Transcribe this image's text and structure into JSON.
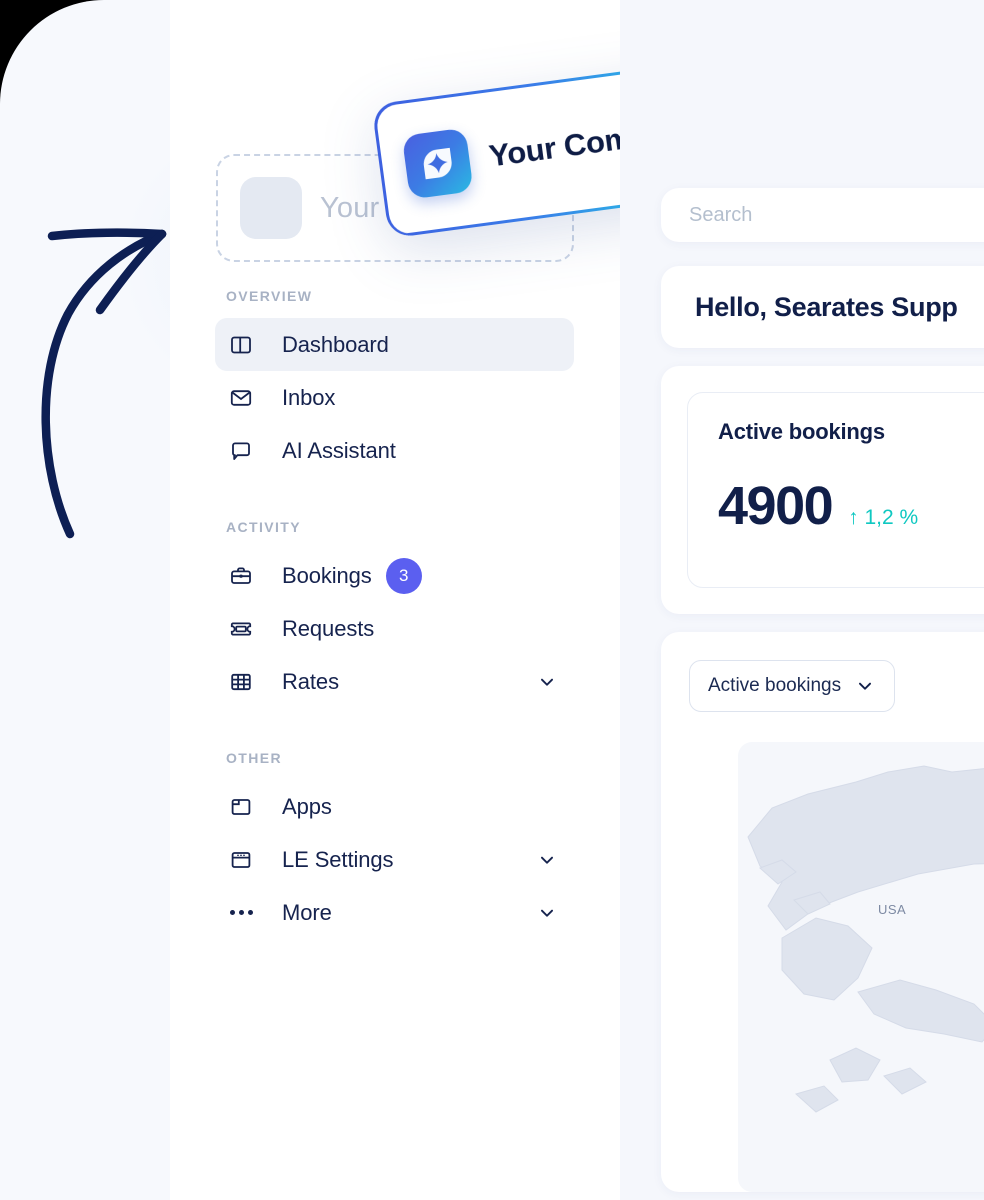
{
  "theme": {
    "page_bg": "#f7f9fd",
    "sidebar_bg": "#ffffff",
    "content_bg": "#f5f7fc",
    "text_primary": "#111f49",
    "text_muted": "#a8b2c4",
    "accent_badge": "#5b5ff0",
    "accent_positive": "#0fc8c1",
    "brand_gradient_from": "#3d5fe0",
    "brand_gradient_to": "#22c6ec",
    "active_item_bg": "#eef1f7"
  },
  "branding": {
    "dropzone_placeholder": "Your Company",
    "card_title": "Your Company",
    "logo_icon": "sparkle-leaf-logo-icon"
  },
  "sidebar": {
    "sections": [
      {
        "label": "OVERVIEW",
        "items": [
          {
            "label": "Dashboard",
            "icon": "layout-panel-icon",
            "active": true,
            "badge": null,
            "chevron": false
          },
          {
            "label": "Inbox",
            "icon": "envelope-icon",
            "active": false,
            "badge": null,
            "chevron": false
          },
          {
            "label": "AI Assistant",
            "icon": "chat-bubble-icon",
            "active": false,
            "badge": null,
            "chevron": false
          }
        ]
      },
      {
        "label": "ACTIVITY",
        "items": [
          {
            "label": "Bookings",
            "icon": "briefcase-icon",
            "active": false,
            "badge": "3",
            "chevron": false
          },
          {
            "label": "Requests",
            "icon": "ticket-icon",
            "active": false,
            "badge": null,
            "chevron": false
          },
          {
            "label": "Rates",
            "icon": "table-grid-icon",
            "active": false,
            "badge": null,
            "chevron": true
          }
        ]
      },
      {
        "label": "OTHER",
        "items": [
          {
            "label": "Apps",
            "icon": "window-icon",
            "active": false,
            "badge": null,
            "chevron": false
          },
          {
            "label": "LE Settings",
            "icon": "browser-panel-icon",
            "active": false,
            "badge": null,
            "chevron": true
          },
          {
            "label": "More",
            "icon": "ellipsis-icon",
            "active": false,
            "badge": null,
            "chevron": true
          }
        ]
      }
    ]
  },
  "content": {
    "search": {
      "placeholder": "Search",
      "icon": "search-icon"
    },
    "greeting": "Hello, Searates Supp",
    "stat_card": {
      "title": "Active bookings",
      "value": "4900",
      "delta": "↑ 1,2 %"
    },
    "map_card": {
      "filter_selected": "Active bookings",
      "filter_chevron": "chevron-down-icon",
      "map_region_label": "USA"
    }
  },
  "annotation": {
    "arrow": "hand-drawn-curved-arrow"
  }
}
